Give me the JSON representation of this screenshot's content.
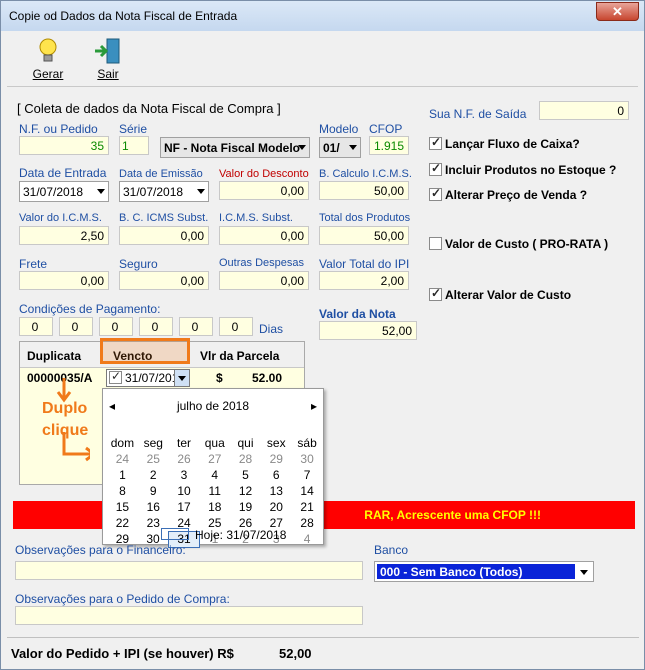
{
  "window": {
    "title": "Copie od Dados da Nota Fiscal de Entrada",
    "close_label": "✕"
  },
  "toolbar": {
    "gerar_label": "Gerar",
    "sair_label": "Sair"
  },
  "section": {
    "coleta_title": "[ Coleta de dados da Nota Fiscal de Compra ]",
    "nf_label": "N.F. ou Pedido",
    "nf_value": "35",
    "serie_label": "Série",
    "serie_value": "1",
    "tipo_value": "NF - Nota Fiscal Modelo",
    "modelo_label": "Modelo",
    "modelo_value": "01/",
    "cfop_label": "CFOP",
    "cfop_value": "1.915",
    "data_entrada_label": "Data de Entrada",
    "data_entrada_value": "31/07/2018",
    "data_emissao_label": "Data de Emissão",
    "data_emissao_value": "31/07/2018",
    "valor_desconto_label": "Valor do Desconto",
    "valor_desconto_value": "0,00",
    "bcalc_icms_label": "B. Calculo I.C.M.S.",
    "bcalc_icms_value": "50,00",
    "valor_icms_label": "Valor do I.C.M.S.",
    "valor_icms_value": "2,50",
    "bc_icms_subst_label": "B. C. ICMS Subst.",
    "bc_icms_subst_value": "0,00",
    "icms_subst_label": "I.C.M.S. Subst.",
    "icms_subst_value": "0,00",
    "total_produtos_label": "Total dos Produtos",
    "total_produtos_value": "50,00",
    "frete_label": "Frete",
    "frete_value": "0,00",
    "seguro_label": "Seguro",
    "seguro_value": "0,00",
    "outras_label": "Outras Despesas",
    "outras_value": "0,00",
    "valor_total_ipi_label": "Valor Total do IPI",
    "valor_total_ipi_value": "2,00",
    "cond_pag_label": "Condições de Pagamento:",
    "cond_values": [
      "0",
      "0",
      "0",
      "0",
      "0",
      "0"
    ],
    "dias_label": "Dias",
    "valor_nota_label": "Valor da Nota",
    "valor_nota_value": "52,00"
  },
  "side": {
    "sua_nf_label": "Sua N.F. de Saída",
    "sua_nf_value": "0",
    "chk_fluxo": "Lançar Fluxo de Caixa?",
    "chk_incluir": "Incluir Produtos no Estoque ?",
    "chk_alterar_preco": "Alterar Preço de Venda ?",
    "chk_custo_prorata": "Valor de Custo ( PRO-RATA )",
    "chk_alterar_custo": "Alterar Valor de Custo"
  },
  "grid": {
    "headers": [
      "Duplicata",
      "Vencto",
      "Vlr da Parcela"
    ],
    "row": {
      "duplicata": "00000035/A",
      "vencto": "31/07/201",
      "currency": "$",
      "valor": "52.00"
    }
  },
  "calendar": {
    "month": "julho de 2018",
    "weekdays": [
      "dom",
      "seg",
      "ter",
      "qua",
      "qui",
      "sex",
      "sáb"
    ],
    "weeks": [
      [
        "24",
        "25",
        "26",
        "27",
        "28",
        "29",
        "30"
      ],
      [
        "1",
        "2",
        "3",
        "4",
        "5",
        "6",
        "7"
      ],
      [
        "8",
        "9",
        "10",
        "11",
        "12",
        "13",
        "14"
      ],
      [
        "15",
        "16",
        "17",
        "18",
        "19",
        "20",
        "21"
      ],
      [
        "22",
        "23",
        "24",
        "25",
        "26",
        "27",
        "28"
      ],
      [
        "29",
        "30",
        "31",
        "1",
        "2",
        "3",
        "4"
      ]
    ],
    "today": "Hoje: 31/07/2018"
  },
  "annotation": {
    "line1": "Duplo",
    "line2": "clique"
  },
  "banner": {
    "text": "RAR, Acrescente uma CFOP !!!"
  },
  "obs": {
    "financeiro_label": "Observações para o Financeiro:",
    "pedido_label": "Observações para o Pedido de Compra:",
    "banco_label": "Banco",
    "banco_value": "000 - Sem Banco (Todos)"
  },
  "footer": {
    "label": "Valor do Pedido + IPI (se houver) R$",
    "value": "52,00"
  }
}
